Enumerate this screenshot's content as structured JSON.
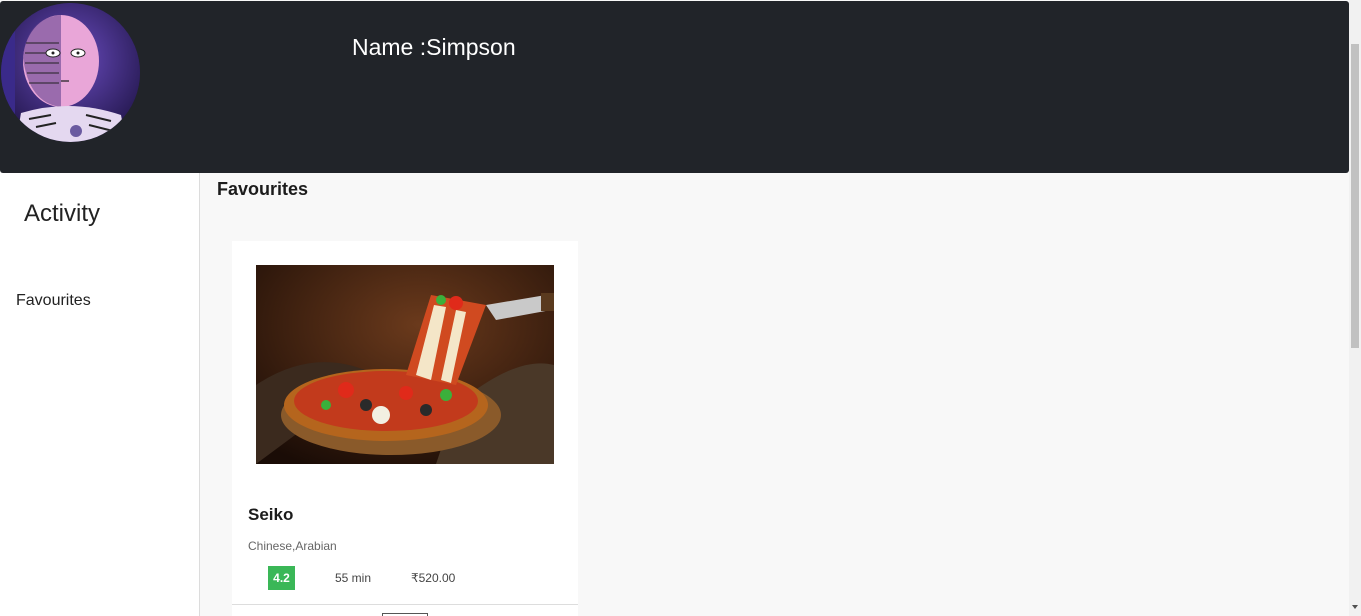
{
  "header": {
    "profile_name": "Name :Simpson"
  },
  "sidebar": {
    "title": "Activity",
    "items": [
      {
        "label": "Favourites"
      }
    ]
  },
  "main": {
    "section_title": "Favourites",
    "cards": [
      {
        "name": "Seiko",
        "cuisine": "Chinese,Arabian",
        "rating": "4.2",
        "time": "55 min",
        "price": "₹520.00"
      }
    ]
  },
  "colors": {
    "header_bg": "#212429",
    "rating_green": "#3ab757",
    "page_bg": "#f8f8f8"
  }
}
